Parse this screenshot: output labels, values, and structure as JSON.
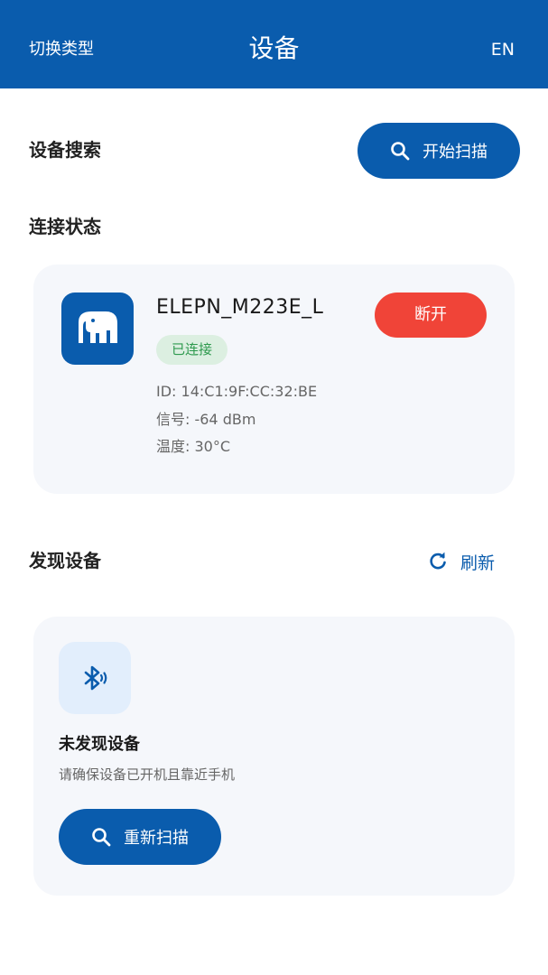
{
  "header": {
    "left_label": "切换类型",
    "title": "设备",
    "right_label": "EN"
  },
  "search_section": {
    "title": "设备搜索",
    "scan_button_label": "开始扫描",
    "scan_button_icon": "search-icon"
  },
  "connection_section": {
    "title": "连接状态",
    "device": {
      "logo_icon": "elephant-logo-icon",
      "name": "ELEPN_M223E_L",
      "status": "已连接",
      "id_line": "ID: 14:C1:9F:CC:32:BE",
      "signal_line": "信号: -64 dBm",
      "temperature_line": "温度: 30°C",
      "disconnect_label": "断开"
    }
  },
  "found_section": {
    "title": "发现设备",
    "refresh_label": "刷新",
    "refresh_icon": "refresh-icon",
    "empty_state": {
      "icon": "bluetooth-searching-icon",
      "title": "未发现设备",
      "hint": "请确保设备已开机且靠近手机",
      "rescan_label": "重新扫描"
    }
  },
  "colors": {
    "primary": "#0a5cad",
    "danger": "#f04438",
    "success_text": "#2e9a4e",
    "success_bg": "#dcefe1",
    "card_bg": "#f5f7fb"
  }
}
